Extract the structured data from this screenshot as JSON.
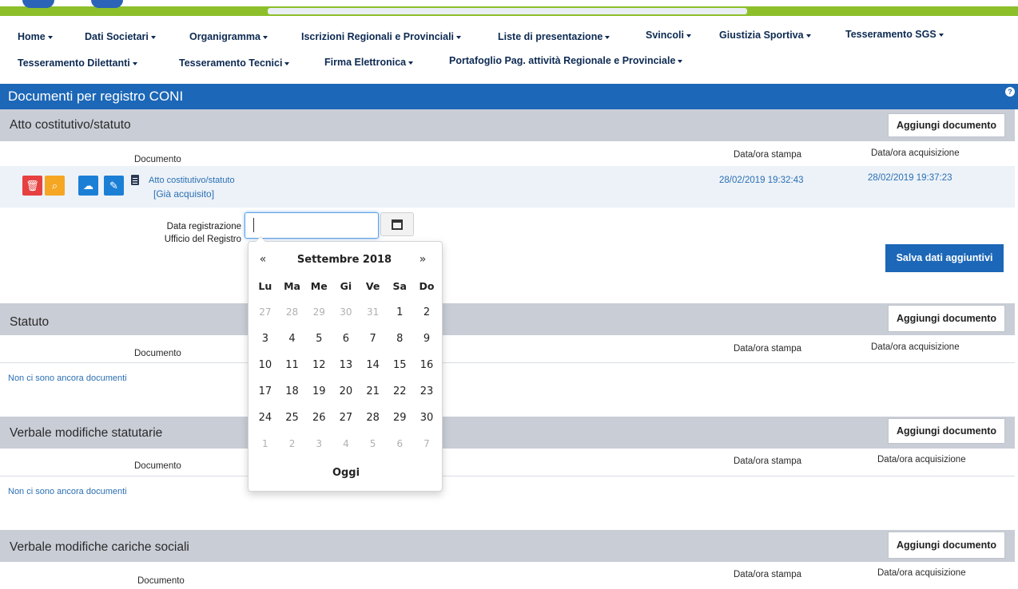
{
  "nav": {
    "row1": [
      "Home",
      "Dati Societari",
      "Organigramma",
      "Iscrizioni Regionali e Provinciali",
      "Liste di presentazione",
      "Svincoli",
      "Giustizia Sportiva",
      "Tesseramento SGS"
    ],
    "row2": [
      "Tesseramento Dilettanti",
      "Tesseramento Tecnici",
      "Firma Elettronica",
      "Portafoglio Pag. attività Regionale e Provinciale"
    ]
  },
  "page_title": "Documenti per registro CONI",
  "help_icon": "?",
  "columns": {
    "documento": "Documento",
    "data_stampa": "Data/ora stampa",
    "data_acquisizione": "Data/ora acquisizione"
  },
  "add_button_label": "Aggiungi documento",
  "sections": [
    {
      "title": "Atto costitutivo/statuto",
      "document": {
        "name": "Atto costitutivo/statuto",
        "status": "[Già acquisito]",
        "data_stampa": "28/02/2019 19:32:43",
        "data_acquisizione": "28/02/2019 19:37:23"
      },
      "fields": {
        "data_registrazione_label": "Data registrazione",
        "ufficio_label": "Ufficio del Registro",
        "data_registrazione_value": ""
      },
      "save_label": "Salva dati aggiuntivi"
    },
    {
      "title": "Statuto",
      "empty_text": "Non ci sono ancora documenti"
    },
    {
      "title": "Verbale modifiche statutarie",
      "empty_text": "Non ci sono ancora documenti"
    },
    {
      "title": "Verbale modifiche cariche sociali"
    }
  ],
  "datepicker": {
    "prev": "«",
    "next": "»",
    "month_title": "Settembre 2018",
    "weekdays": [
      "Lu",
      "Ma",
      "Me",
      "Gi",
      "Ve",
      "Sa",
      "Do"
    ],
    "weeks": [
      [
        {
          "d": "27",
          "m": true
        },
        {
          "d": "28",
          "m": true
        },
        {
          "d": "29",
          "m": true
        },
        {
          "d": "30",
          "m": true
        },
        {
          "d": "31",
          "m": true
        },
        {
          "d": "1"
        },
        {
          "d": "2"
        }
      ],
      [
        {
          "d": "3"
        },
        {
          "d": "4"
        },
        {
          "d": "5"
        },
        {
          "d": "6"
        },
        {
          "d": "7"
        },
        {
          "d": "8"
        },
        {
          "d": "9"
        }
      ],
      [
        {
          "d": "10"
        },
        {
          "d": "11"
        },
        {
          "d": "12"
        },
        {
          "d": "13"
        },
        {
          "d": "14"
        },
        {
          "d": "15"
        },
        {
          "d": "16"
        }
      ],
      [
        {
          "d": "17"
        },
        {
          "d": "18"
        },
        {
          "d": "19"
        },
        {
          "d": "20"
        },
        {
          "d": "21"
        },
        {
          "d": "22"
        },
        {
          "d": "23"
        }
      ],
      [
        {
          "d": "24"
        },
        {
          "d": "25"
        },
        {
          "d": "26"
        },
        {
          "d": "27"
        },
        {
          "d": "28"
        },
        {
          "d": "29"
        },
        {
          "d": "30"
        }
      ],
      [
        {
          "d": "1",
          "m": true
        },
        {
          "d": "2",
          "m": true
        },
        {
          "d": "3",
          "m": true
        },
        {
          "d": "4",
          "m": true
        },
        {
          "d": "5",
          "m": true
        },
        {
          "d": "6",
          "m": true
        },
        {
          "d": "7",
          "m": true
        }
      ]
    ],
    "today_label": "Oggi"
  }
}
